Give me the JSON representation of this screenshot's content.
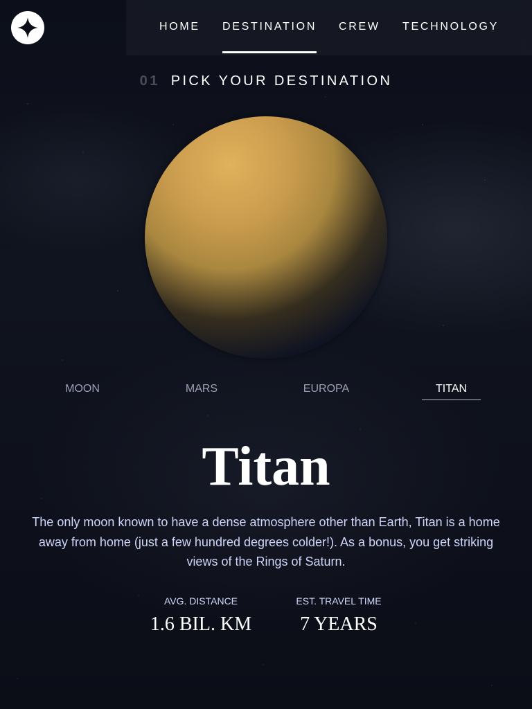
{
  "header": {
    "logo_icon": "star-logo-icon",
    "nav": [
      {
        "label": "HOME"
      },
      {
        "label": "DESTINATION",
        "active": true
      },
      {
        "label": "CREW"
      },
      {
        "label": "TECHNOLOGY"
      }
    ]
  },
  "page": {
    "number": "01",
    "heading": "PICK YOUR DESTINATION"
  },
  "planet": {
    "name": "Titan",
    "image": "titan-planet-image"
  },
  "tabs": [
    {
      "label": "MOON"
    },
    {
      "label": "MARS"
    },
    {
      "label": "EUROPA"
    },
    {
      "label": "TITAN",
      "active": true
    }
  ],
  "destination": {
    "name": "Titan",
    "description": "The only moon known to have a dense atmosphere other than Earth, Titan is a home away from home (just a few hundred degrees colder!). As a bonus, you get striking views of the Rings of Saturn.",
    "stats": [
      {
        "label": "AVG. DISTANCE",
        "value": "1.6 BIL. KM"
      },
      {
        "label": "EST. TRAVEL TIME",
        "value": "7 YEARS"
      }
    ]
  },
  "colors": {
    "background": "#0b0d17",
    "text": "#ffffff",
    "muted_text": "#d0d6f9",
    "tab_inactive": "#9ba0b5"
  }
}
